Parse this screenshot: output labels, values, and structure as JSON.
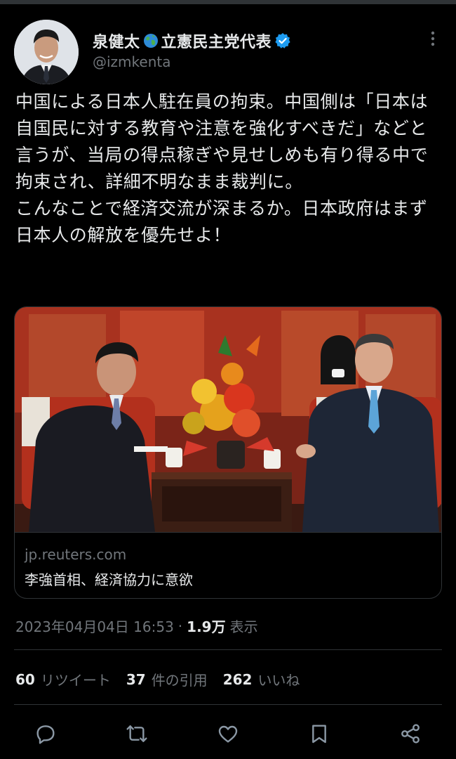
{
  "author": {
    "display_name": "泉健太",
    "display_name_suffix": "立憲民主党代表",
    "handle": "@izmkenta",
    "avatar_icon": "avatar-photo",
    "verified_icon": "verified-badge-icon",
    "globe_icon": "globe-emoji-icon"
  },
  "tweet": {
    "text": "中国による日本人駐在員の拘束。中国側は「日本は自国民に対する教育や注意を強化すべきだ」などと言うが、当局の得点稼ぎや見せしめも有り得る中で拘束され、詳細不明なまま裁判に。\nこんなことで経済交流が深まるか。日本政府はまず日本人の解放を優先せよ！"
  },
  "card": {
    "domain": "jp.reuters.com",
    "title": "李強首相、経済協力に意欲"
  },
  "meta": {
    "timestamp": "2023年04月04日 16:53",
    "separator": "·",
    "views_count": "1.9万",
    "views_label": "表示"
  },
  "stats": {
    "retweets_count": "60",
    "retweets_label": "リツイート",
    "quotes_count": "37",
    "quotes_label": "件の引用",
    "likes_count": "262",
    "likes_label": "いいね"
  },
  "colors": {
    "background": "#000000",
    "text": "#e7e9ea",
    "secondary": "#71767b",
    "border": "#2f3336",
    "verified": "#1d9bf0"
  }
}
